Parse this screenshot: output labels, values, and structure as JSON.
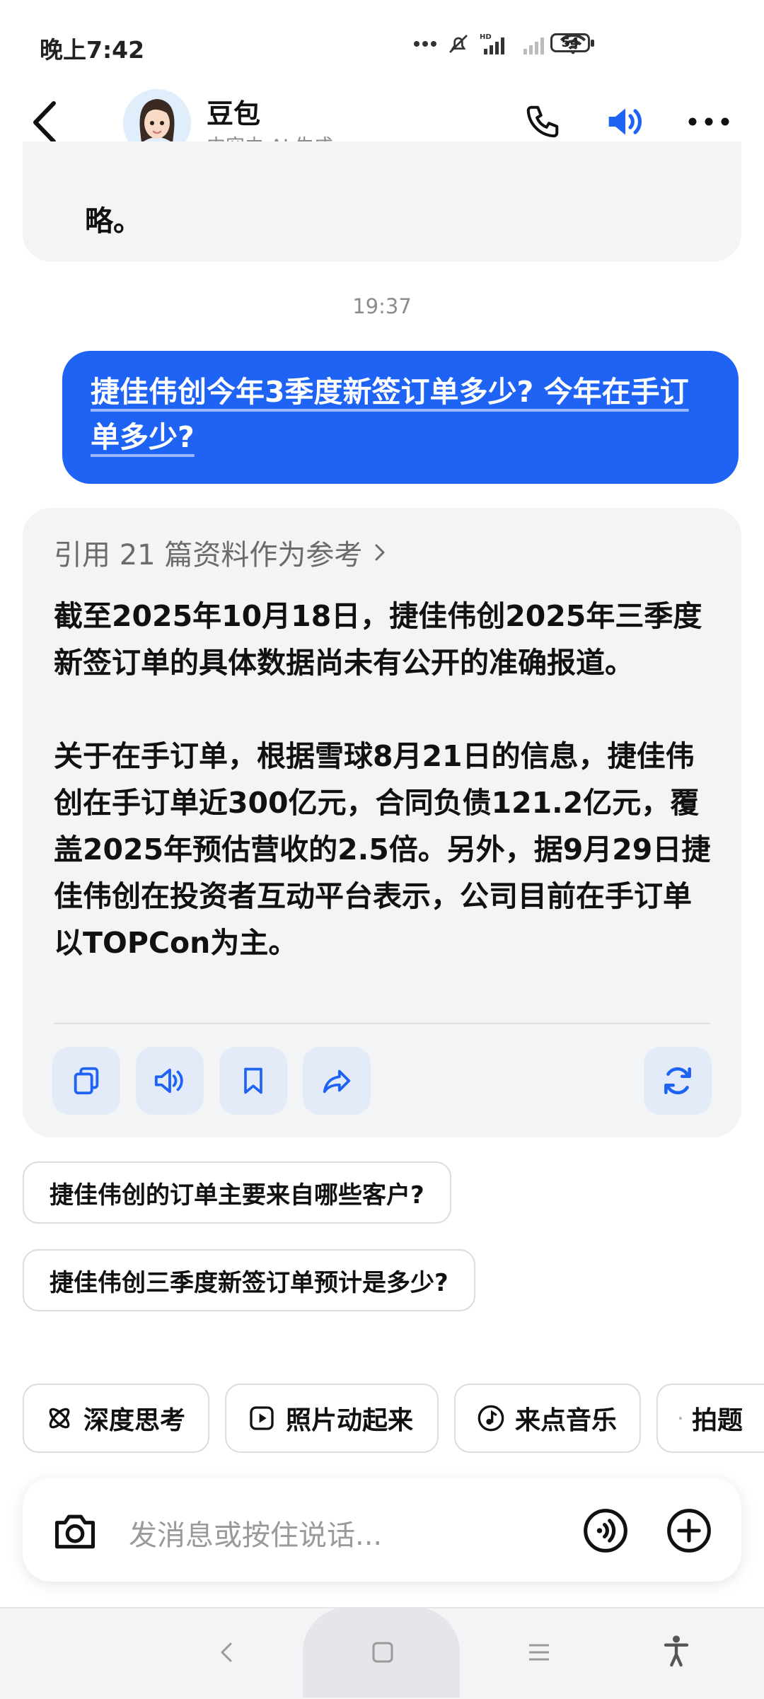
{
  "status": {
    "time": "晚上7:42",
    "battery": "54"
  },
  "header": {
    "name": "豆包",
    "subtitle": "内容由 AI 生成"
  },
  "chat": {
    "prev_tail": "略。",
    "timestamp": "19:37",
    "user_message": "捷佳伟创今年3季度新签订单多少? 今年在手订单多少?",
    "refs_label": "引用 21 篇资料作为参考",
    "answer_p1": "截至2025年10月18日，捷佳伟创2025年三季度新签订单的具体数据尚未有公开的准确报道。",
    "answer_p2": "关于在手订单，根据雪球8月21日的信息，捷佳伟创在手订单近300亿元，合同负债121.2亿元，覆盖2025年预估营收的2.5倍。另外，据9月29日捷佳伟创在投资者互动平台表示，公司目前在手订单以TOPCon为主。"
  },
  "suggestions": [
    "捷佳伟创的订单主要来自哪些客户?",
    "捷佳伟创三季度新签订单预计是多少?"
  ],
  "chips": [
    "深度思考",
    "照片动起来",
    "来点音乐",
    "拍题"
  ],
  "input": {
    "placeholder": "发消息或按住说话..."
  },
  "colors": {
    "accent": "#1f63f5",
    "card": "#f3f4f6"
  }
}
